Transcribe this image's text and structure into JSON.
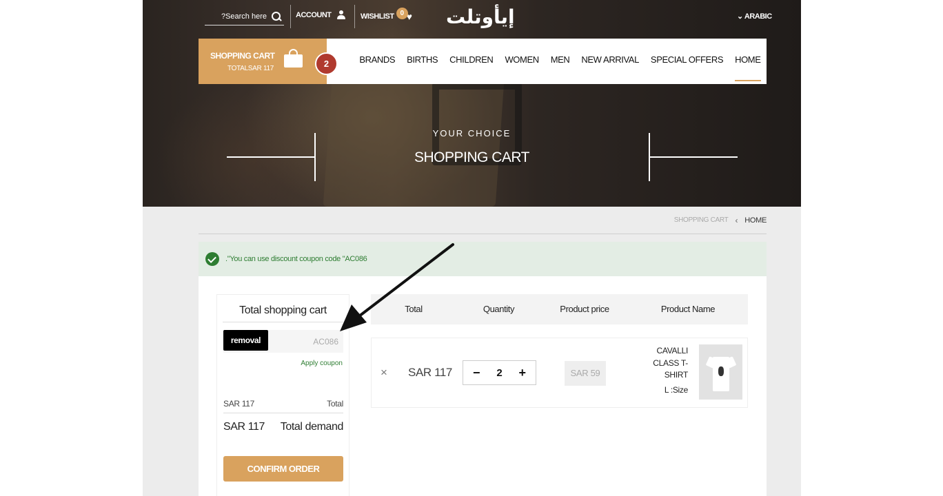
{
  "topbar": {
    "search_placeholder": "?Search here",
    "account_label": "ACCOUNT",
    "wishlist_label": "WISHLIST",
    "wishlist_count": "0",
    "logo_text": "إيأوتلت",
    "language_label": "ARABIC"
  },
  "cart_widget": {
    "title": "SHOPPING CART",
    "total": "TOTALSAR 117",
    "count": "2"
  },
  "nav": {
    "items": [
      "BRANDS",
      "BIRTHS",
      "CHILDREN",
      "WOMEN",
      "MEN",
      "NEW ARRIVAL",
      "SPECIAL OFFERS",
      "HOME"
    ],
    "active": "HOME"
  },
  "hero": {
    "subtitle": "YOUR CHOICE",
    "title": "SHOPPING CART"
  },
  "breadcrumb": {
    "current": "SHOPPING CART",
    "separator": "‹",
    "home": "HOME"
  },
  "alert": {
    "message": ".\"You can use discount coupon code \"AC086"
  },
  "summary": {
    "title": "Total shopping cart",
    "removal_button": "removal",
    "coupon_value": "AC086",
    "apply_link": "Apply coupon",
    "total_value": "SAR 117",
    "total_label": "Total",
    "demand_value": "SAR 117",
    "demand_label": "Total demand",
    "confirm_button": "CONFIRM ORDER"
  },
  "table": {
    "headers": {
      "total": "Total",
      "quantity": "Quantity",
      "product_price": "Product price",
      "product_name": "Product Name"
    },
    "rows": [
      {
        "remove": "×",
        "total": "SAR 117",
        "quantity": "2",
        "minus": "−",
        "plus": "+",
        "price": "SAR 59",
        "name": "CAVALLI CLASS T-SHIRT",
        "size": "L :Size"
      }
    ]
  },
  "colors": {
    "accent": "#d9a25e",
    "badge_red": "#b03a2e",
    "success_green": "#2e7d32",
    "alert_bg": "#e3ede4"
  }
}
